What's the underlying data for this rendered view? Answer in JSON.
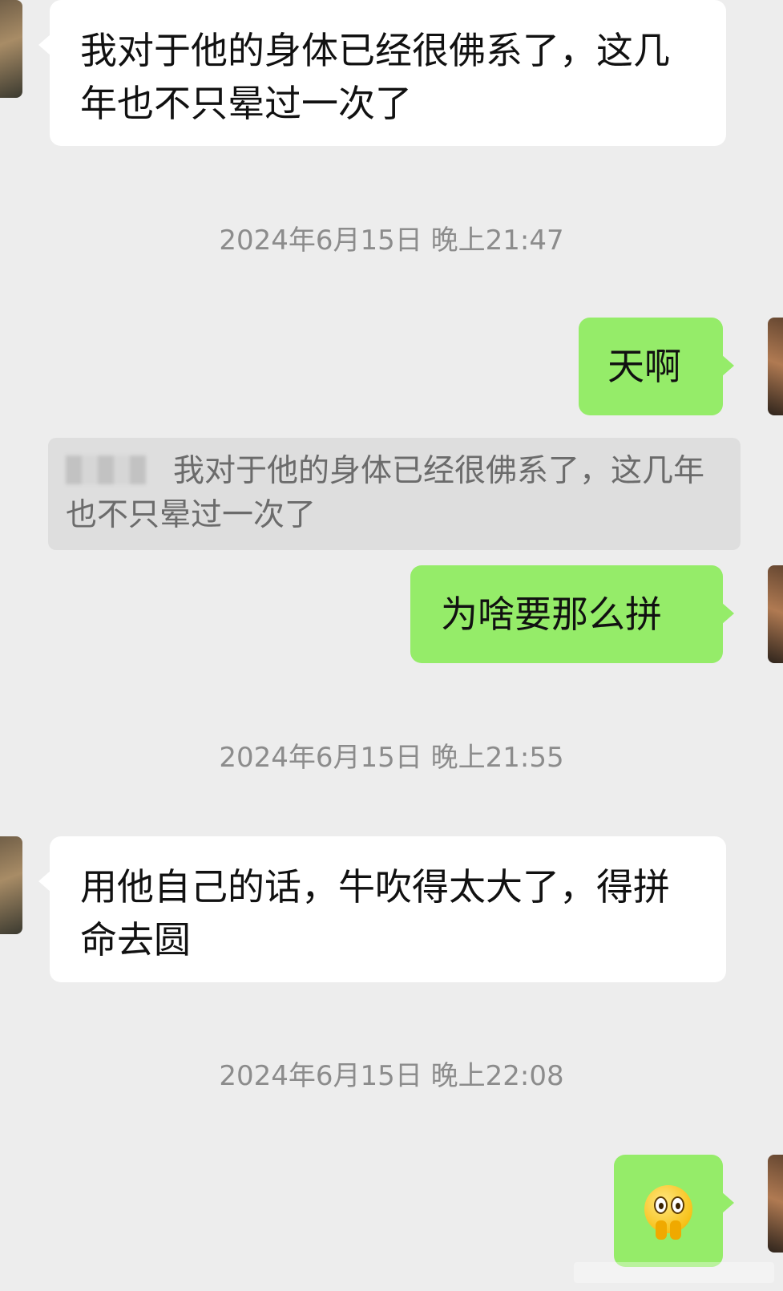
{
  "messages": [
    {
      "id": "m1",
      "side": "received",
      "text": "我对于他的身体已经很佛系了，这几年也不只晕过一次了"
    },
    {
      "id": "t1",
      "side": "timestamp",
      "text": "2024年6月15日 晚上21:47"
    },
    {
      "id": "m2",
      "side": "sent",
      "text": "天啊"
    },
    {
      "id": "q1",
      "side": "quote",
      "text": "我对于他的身体已经很佛系了，这几年也不只晕过一次了"
    },
    {
      "id": "m3",
      "side": "sent",
      "text": "为啥要那么拼"
    },
    {
      "id": "t2",
      "side": "timestamp",
      "text": "2024年6月15日 晚上21:55"
    },
    {
      "id": "m4",
      "side": "received",
      "text": "用他自己的话，牛吹得太大了，得拼命去圆"
    },
    {
      "id": "t3",
      "side": "timestamp",
      "text": "2024年6月15日 晚上22:08"
    },
    {
      "id": "m5",
      "side": "sent",
      "emoji": "grinning-face-emoji"
    }
  ],
  "colors": {
    "background": "#ededed",
    "received_bubble": "#ffffff",
    "sent_bubble": "#95ec69",
    "timestamp_text": "#8c8c8c",
    "quote_background": "#dedede"
  }
}
